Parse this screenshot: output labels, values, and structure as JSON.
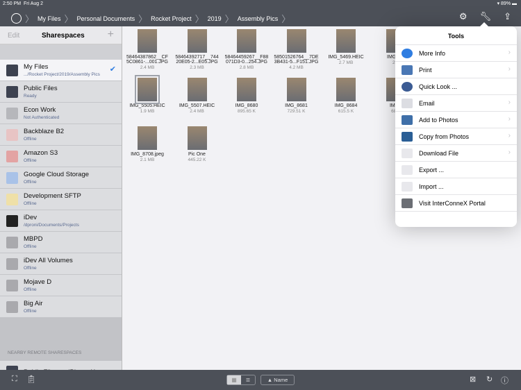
{
  "status": {
    "time": "2:50 PM",
    "date": "Fri Aug 2",
    "battery": "89%"
  },
  "breadcrumb": [
    "My Files",
    "Personal Documents",
    "Rocket Project",
    "2019",
    "Assembly Pics"
  ],
  "sidebar": {
    "edit": "Edit",
    "title": "Sharespaces",
    "add": "+",
    "items": [
      {
        "name": "My Files",
        "status": ".../Rocket Project/2019/Assembly Pics",
        "selected": true,
        "color": "#3d4250"
      },
      {
        "name": "Public Files",
        "status": "Ready",
        "color": "#3d4250"
      },
      {
        "name": "Econ Work",
        "status": "Not Authenticated",
        "color": "#b6b7bb"
      },
      {
        "name": "Backblaze B2",
        "status": "Offline",
        "color": "#e8c4c4"
      },
      {
        "name": "Amazon S3",
        "status": "Offline",
        "color": "#e3a3a3"
      },
      {
        "name": "Google Cloud Storage",
        "status": "Offline",
        "color": "#a9c2e8"
      },
      {
        "name": "Development SFTP",
        "status": "Offline",
        "color": "#efe0a8"
      },
      {
        "name": "iDev",
        "status": "/dproni/Documents/Projects",
        "color": "#222"
      },
      {
        "name": "MBPD",
        "status": "Offline",
        "color": "#a9a9ad"
      },
      {
        "name": "iDev All Volumes",
        "status": "Offline",
        "color": "#a9a9ad"
      },
      {
        "name": "Mojave D",
        "status": "Offline",
        "color": "#a9a9ad"
      },
      {
        "name": "Big Air",
        "status": "Offline",
        "color": "#a9a9ad"
      }
    ],
    "nearby_header": "NEARBY REMOTE SHARESPACES",
    "nearby": [
      {
        "name": "Public Files on iPhone Xʀ",
        "color": "#3d4250"
      }
    ]
  },
  "files": [
    {
      "name": "58464387862__CF 5C0861-...001.JPG",
      "size": "2.4 MB"
    },
    {
      "name": "58464392717__744 20E05-2...E05.JPG",
      "size": "2.3 MB"
    },
    {
      "name": "58464459267__F88 071D3-0...254.JPG",
      "size": "2.8 MB"
    },
    {
      "name": "58501526764__7DE 3B431-5...F151.JPG",
      "size": "4.2 MB"
    },
    {
      "name": "IMG_5469.HEIC",
      "size": "2.7 MB"
    },
    {
      "name": "IMG_54",
      "size": "2.6"
    },
    {
      "name": "IMG_5505.HEIC",
      "size": "1.9 MB",
      "selected": true
    },
    {
      "name": "IMG_5507.HEIC",
      "size": "2.4 MB"
    },
    {
      "name": "IMG_8680",
      "size": "895.65 K"
    },
    {
      "name": "IMG_8681",
      "size": "729.51 K"
    },
    {
      "name": "IMG_8684",
      "size": "615.5 K"
    },
    {
      "name": "IMG_",
      "size": "683."
    },
    {
      "name": "IMG_8708.jpeg",
      "size": "2.1 MB"
    },
    {
      "name": "Pic One",
      "size": "445.22 K"
    }
  ],
  "tools": {
    "title": "Tools",
    "items": [
      {
        "label": "More Info",
        "icon": "info-icon",
        "chevron": true,
        "color": "#2f7de1"
      },
      {
        "label": "Print",
        "icon": "printer-icon",
        "chevron": true,
        "color": "#4a77b4"
      },
      {
        "label": "Quick Look ...",
        "icon": "eye-icon",
        "chevron": false,
        "color": "#3b5b93"
      },
      {
        "label": "Email",
        "icon": "envelope-icon",
        "chevron": true,
        "color": "#dcdde2"
      },
      {
        "label": "Add to Photos",
        "icon": "add-photos-icon",
        "chevron": true,
        "color": "#3f6fa8"
      },
      {
        "label": "Copy from Photos",
        "icon": "photo-icon",
        "chevron": true,
        "color": "#2a5e95"
      },
      {
        "label": "Download File",
        "icon": "download-file-icon",
        "chevron": true,
        "color": "#e8e8ec"
      },
      {
        "label": "Export ...",
        "icon": "export-icon",
        "chevron": false,
        "color": "#e8e8ec"
      },
      {
        "label": "Import ...",
        "icon": "import-icon",
        "chevron": false,
        "color": "#e8e8ec"
      },
      {
        "label": "Visit InterConneX Portal",
        "icon": "portal-icon",
        "chevron": false,
        "color": "#6b6e74"
      }
    ]
  },
  "bottom": {
    "sort": "▲ Name",
    "grid": "▦",
    "list": "≣"
  }
}
